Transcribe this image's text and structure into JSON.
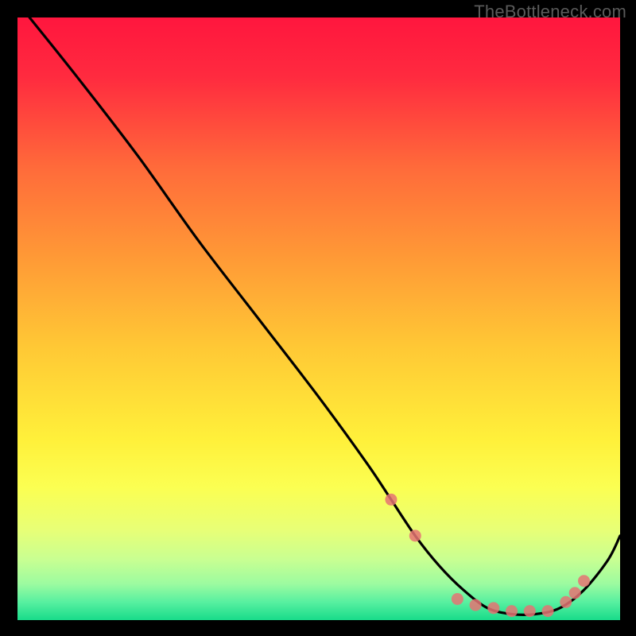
{
  "attribution": "TheBottleneck.com",
  "chart_data": {
    "type": "line",
    "title": "",
    "xlabel": "",
    "ylabel": "",
    "x_range": [
      0,
      100
    ],
    "y_range": [
      0,
      100
    ],
    "series": [
      {
        "name": "bottleneck-curve",
        "x": [
          2,
          10,
          20,
          30,
          40,
          50,
          58,
          62,
          66,
          70,
          74,
          78,
          82,
          86,
          90,
          94,
          98,
          100
        ],
        "y": [
          100,
          90,
          77,
          63,
          50,
          37,
          26,
          20,
          14,
          9,
          5,
          2,
          1,
          1,
          2,
          5,
          10,
          14
        ]
      }
    ],
    "markers": {
      "name": "highlighted-points",
      "x": [
        62,
        66,
        73,
        76,
        79,
        82,
        85,
        88,
        91,
        92.5,
        94
      ],
      "y": [
        20,
        14,
        3.5,
        2.5,
        2,
        1.5,
        1.5,
        1.5,
        3,
        4.5,
        6.5
      ]
    },
    "background_gradient": {
      "stops": [
        {
          "offset": 0.0,
          "color": "#ff163e"
        },
        {
          "offset": 0.1,
          "color": "#ff2b3f"
        },
        {
          "offset": 0.25,
          "color": "#ff6b3a"
        },
        {
          "offset": 0.4,
          "color": "#ff9a36"
        },
        {
          "offset": 0.55,
          "color": "#ffc935"
        },
        {
          "offset": 0.7,
          "color": "#fff03a"
        },
        {
          "offset": 0.78,
          "color": "#fbff52"
        },
        {
          "offset": 0.85,
          "color": "#e8ff76"
        },
        {
          "offset": 0.9,
          "color": "#c8ff92"
        },
        {
          "offset": 0.94,
          "color": "#9cfba0"
        },
        {
          "offset": 0.97,
          "color": "#58f0a0"
        },
        {
          "offset": 1.0,
          "color": "#18db8a"
        }
      ]
    }
  }
}
